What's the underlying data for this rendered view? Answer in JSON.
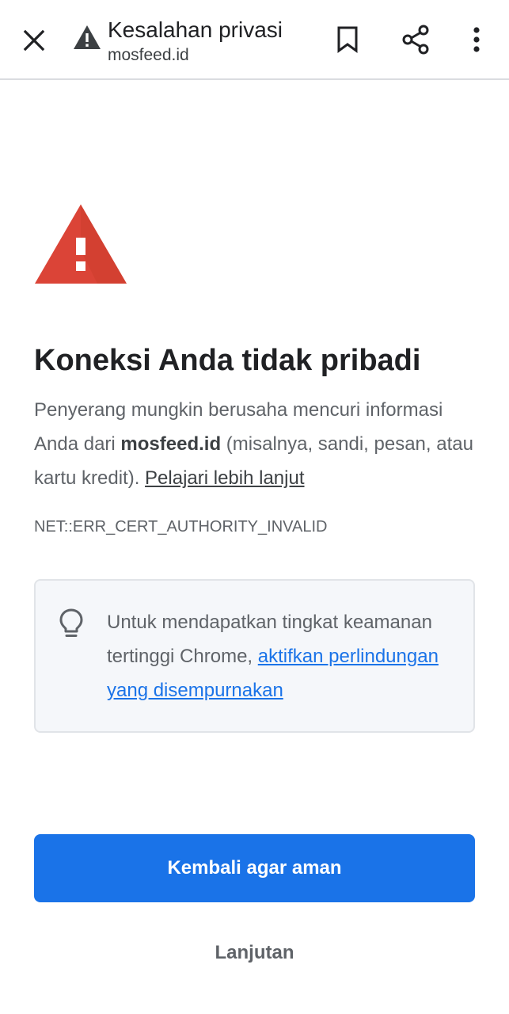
{
  "toolbar": {
    "close_icon": "close-icon",
    "warning_icon": "warning-icon",
    "title": "Kesalahan privasi",
    "url": "mosfeed.id",
    "bookmark_icon": "bookmark-icon",
    "share_icon": "share-icon",
    "menu_icon": "more-vert-icon"
  },
  "interstitial": {
    "warning_icon": "warning-triangle-icon",
    "heading": "Koneksi Anda tidak pribadi",
    "body_part1": "Penyerang mungkin berusaha mencuri informasi Anda dari ",
    "body_domain": "mosfeed.id",
    "body_part2": " (misalnya, sandi, pesan, atau kartu kredit). ",
    "learn_more": "Pelajari lebih lanjut",
    "error_code": "NET::ERR_CERT_AUTHORITY_INVALID",
    "tip": {
      "icon": "lightbulb-icon",
      "text": "Untuk mendapatkan tingkat keamanan tertinggi Chrome, ",
      "link": "aktifkan perlindungan yang disempurnakan"
    },
    "primary_button": "Kembali agar aman",
    "secondary_button": "Lanjutan"
  },
  "colors": {
    "accent": "#1a73e8",
    "warning_red": "#db4437",
    "text_primary": "#202124",
    "text_secondary": "#5f6368"
  }
}
